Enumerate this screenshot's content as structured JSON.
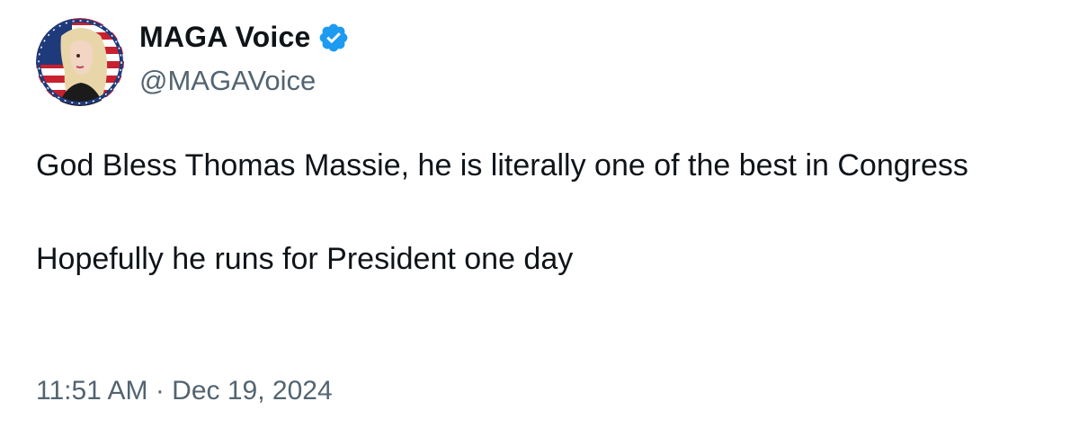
{
  "author": {
    "display_name": "MAGA Voice",
    "handle": "@MAGAVoice",
    "verified": true,
    "verified_color": "#1d9bf0",
    "avatar_icon": "profile-avatar-portrait-flag"
  },
  "tweet": {
    "paragraphs": [
      "God Bless Thomas Massie, he is literally one of the best in Congress",
      "Hopefully he runs for President one day"
    ],
    "timestamp": "11:51 AM · Dec 19, 2024"
  },
  "colors": {
    "text_primary": "#0f1419",
    "text_secondary": "#536471",
    "background": "#ffffff"
  }
}
